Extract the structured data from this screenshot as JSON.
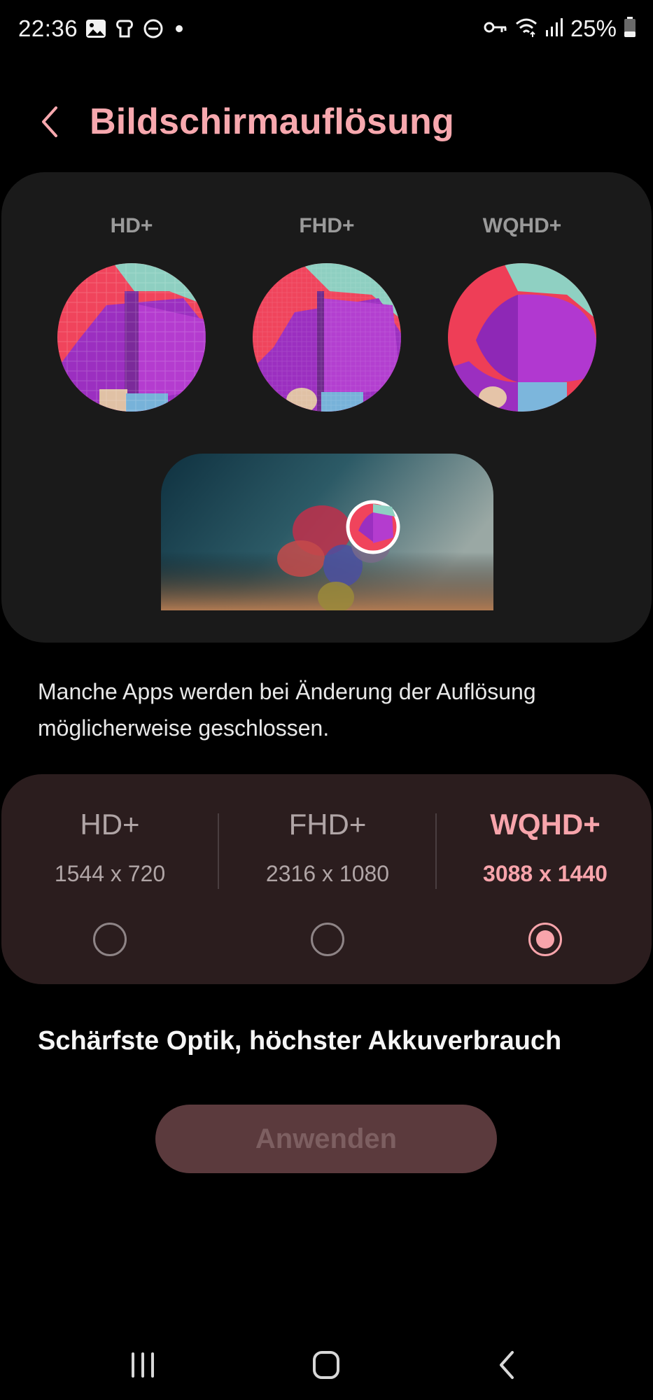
{
  "status_bar": {
    "time": "22:36",
    "battery": "25%",
    "icons_left": [
      "gallery-icon",
      "clip-icon",
      "dnd-icon",
      "dot-icon"
    ],
    "icons_right": [
      "key-icon",
      "wifi-icon",
      "signal-icon",
      "battery-icon"
    ]
  },
  "header": {
    "title": "Bildschirmauflösung",
    "back_icon": "chevron-left-icon"
  },
  "preview": {
    "labels": [
      "HD+",
      "FHD+",
      "WQHD+"
    ]
  },
  "info_text": "Manche Apps werden bei Änderung der Auflösung möglicherweise geschlossen.",
  "options": [
    {
      "name": "HD+",
      "resolution": "1544 x 720",
      "selected": false
    },
    {
      "name": "FHD+",
      "resolution": "2316 x 1080",
      "selected": false
    },
    {
      "name": "WQHD+",
      "resolution": "3088 x 1440",
      "selected": true
    }
  ],
  "description": "Schärfste Optik, höchster Akkuverbrauch",
  "apply_button": "Anwenden",
  "nav_bar": [
    "recents-icon",
    "home-icon",
    "back-icon"
  ],
  "colors": {
    "accent": "#f7a4ab",
    "card": "#1a1a1a",
    "options_card": "#2b1d1e",
    "button_bg": "#5b3a3d"
  }
}
